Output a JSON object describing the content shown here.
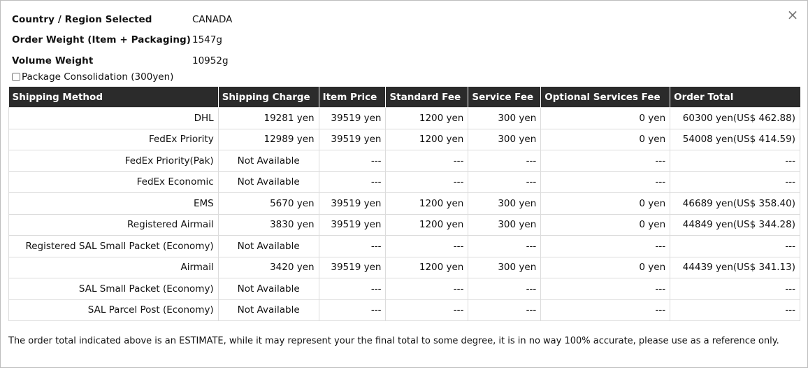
{
  "close_symbol": "×",
  "info": {
    "country_label": "Country / Region Selected",
    "country_value": "CANADA",
    "weight_label": "Order Weight (Item + Packaging)",
    "weight_value": "1547g",
    "volume_label": "Volume Weight",
    "volume_value": "10952g"
  },
  "consolidation": {
    "label": "Package Consolidation (300yen)",
    "checked": false
  },
  "table": {
    "headers": [
      "Shipping Method",
      "Shipping Charge",
      "Item Price",
      "Standard Fee",
      "Service Fee",
      "Optional Services Fee",
      "Order Total"
    ],
    "rows": [
      [
        "DHL",
        "19281 yen",
        "39519 yen",
        "1200 yen",
        "300 yen",
        "0 yen",
        "60300 yen(US$ 462.88)"
      ],
      [
        "FedEx Priority",
        "12989 yen",
        "39519 yen",
        "1200 yen",
        "300 yen",
        "0 yen",
        "54008 yen(US$ 414.59)"
      ],
      [
        "FedEx Priority(Pak)",
        "Not Available",
        "---",
        "---",
        "---",
        "---",
        "---"
      ],
      [
        "FedEx Economic",
        "Not Available",
        "---",
        "---",
        "---",
        "---",
        "---"
      ],
      [
        "EMS",
        "5670 yen",
        "39519 yen",
        "1200 yen",
        "300 yen",
        "0 yen",
        "46689 yen(US$ 358.40)"
      ],
      [
        "Registered Airmail",
        "3830 yen",
        "39519 yen",
        "1200 yen",
        "300 yen",
        "0 yen",
        "44849 yen(US$ 344.28)"
      ],
      [
        "Registered SAL Small Packet (Economy)",
        "Not Available",
        "---",
        "---",
        "---",
        "---",
        "---"
      ],
      [
        "Airmail",
        "3420 yen",
        "39519 yen",
        "1200 yen",
        "300 yen",
        "0 yen",
        "44439 yen(US$ 341.13)"
      ],
      [
        "SAL Small Packet (Economy)",
        "Not Available",
        "---",
        "---",
        "---",
        "---",
        "---"
      ],
      [
        "SAL Parcel Post (Economy)",
        "Not Available",
        "---",
        "---",
        "---",
        "---",
        "---"
      ]
    ]
  },
  "note": "The order total indicated above is an ESTIMATE, while it may represent your the final total to some degree, it is in no way 100% accurate, please use as a reference only."
}
